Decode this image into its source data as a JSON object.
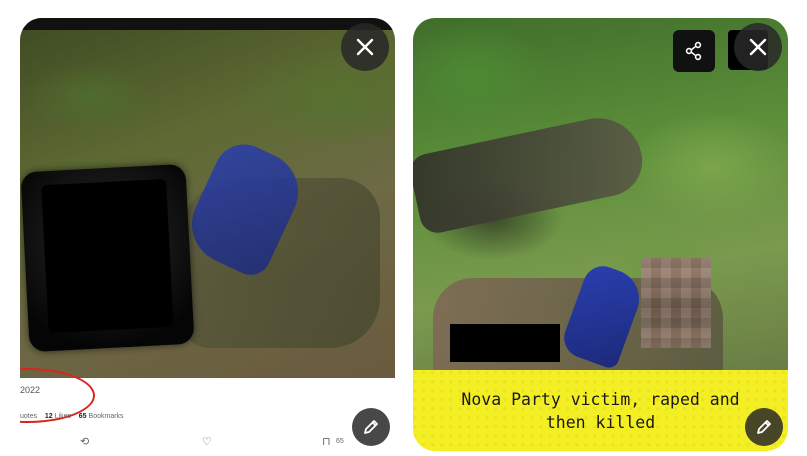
{
  "left_card": {
    "tweet": {
      "date_fragment": "2022",
      "stats": {
        "quotes_label": "uotes",
        "likes_count": "12",
        "likes_label": "Likes",
        "bookmarks_count": "65",
        "bookmarks_label": "Bookmarks"
      },
      "actions": {
        "retweet_glyph": "⟲",
        "like_glyph": "♡",
        "bookmark_glyph": "⊓",
        "bookmark_count": "65"
      }
    },
    "buttons": {
      "close_icon": "close-icon",
      "edit_icon": "pencil-icon"
    }
  },
  "right_card": {
    "caption": "Nova Party victim, raped and then killed",
    "caption_bg": "#f4ee24",
    "buttons": {
      "share_icon": "share-icon",
      "close_icon": "close-icon",
      "edit_icon": "pencil-icon"
    }
  },
  "colors": {
    "overlay_button": "#282828",
    "annotation_red": "#d9261c",
    "cloth_blue": "#2a3fb0"
  }
}
